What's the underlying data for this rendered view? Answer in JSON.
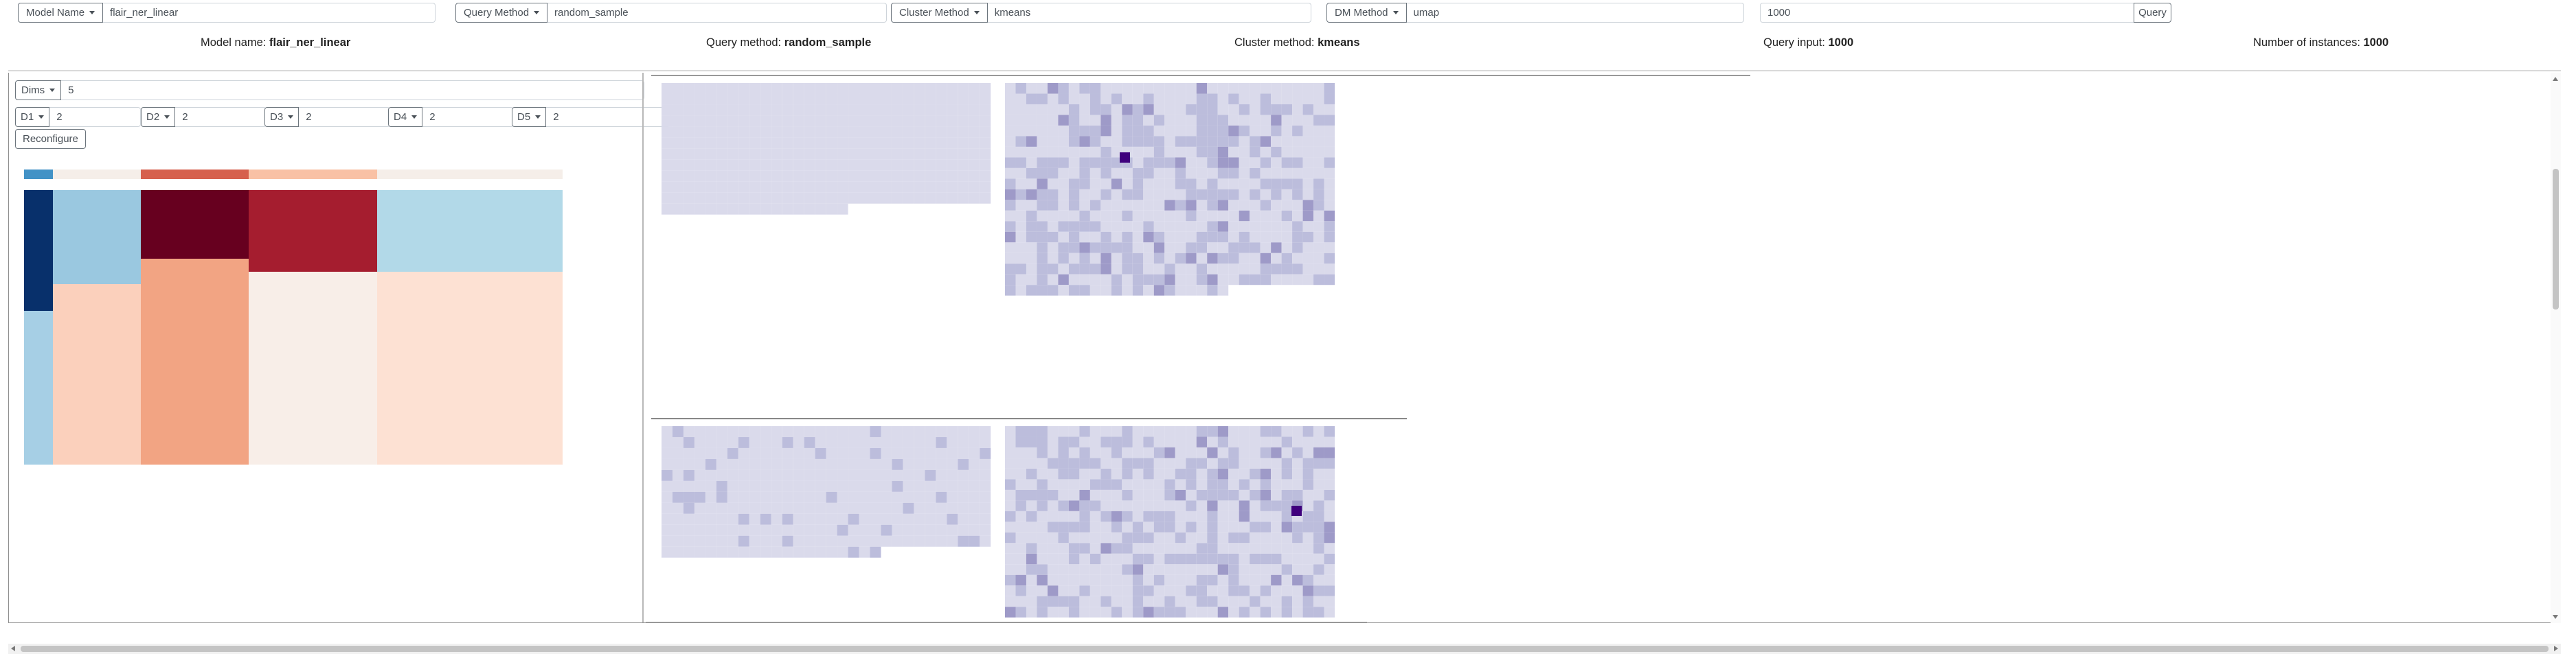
{
  "query_bar": {
    "model": {
      "label": "Model Name",
      "value": "flair_ner_linear"
    },
    "query": {
      "label": "Query Method",
      "value": "random_sample"
    },
    "cluster": {
      "label": "Cluster Method",
      "value": "kmeans"
    },
    "dm": {
      "label": "DM Method",
      "value": "umap"
    },
    "query_input": "1000",
    "query_button": "Query"
  },
  "info": {
    "model_label": "Model name:",
    "model_value": "flair_ner_linear",
    "query_label": "Query method:",
    "query_value": "random_sample",
    "cluster_label": "Cluster method:",
    "cluster_value": "kmeans",
    "input_label": "Query input:",
    "input_value": "1000",
    "instances_label": "Number of instances:",
    "instances_value": "1000"
  },
  "dims": {
    "label": "Dims",
    "value": "5",
    "items": [
      {
        "label": "D1",
        "value": "2"
      },
      {
        "label": "D2",
        "value": "2"
      },
      {
        "label": "D3",
        "value": "2"
      },
      {
        "label": "D4",
        "value": "2"
      },
      {
        "label": "D5",
        "value": "2"
      }
    ],
    "reconfigure_label": "Reconfigure"
  },
  "colors": {
    "treemap": [
      "#08306b",
      "#9ecae1",
      "#67001f",
      "#a51d2f",
      "#b2d9e8",
      "#fbd0bc",
      "#f4a582",
      "#f8eee8",
      "#fde0d2",
      "#4292c6",
      "#d6604d"
    ],
    "heatmap_base": "#dadaeb",
    "heatmap_mid": "#bcbddc",
    "heatmap_dark": "#9e9ac8",
    "heatmap_max": "#3f007d"
  }
}
